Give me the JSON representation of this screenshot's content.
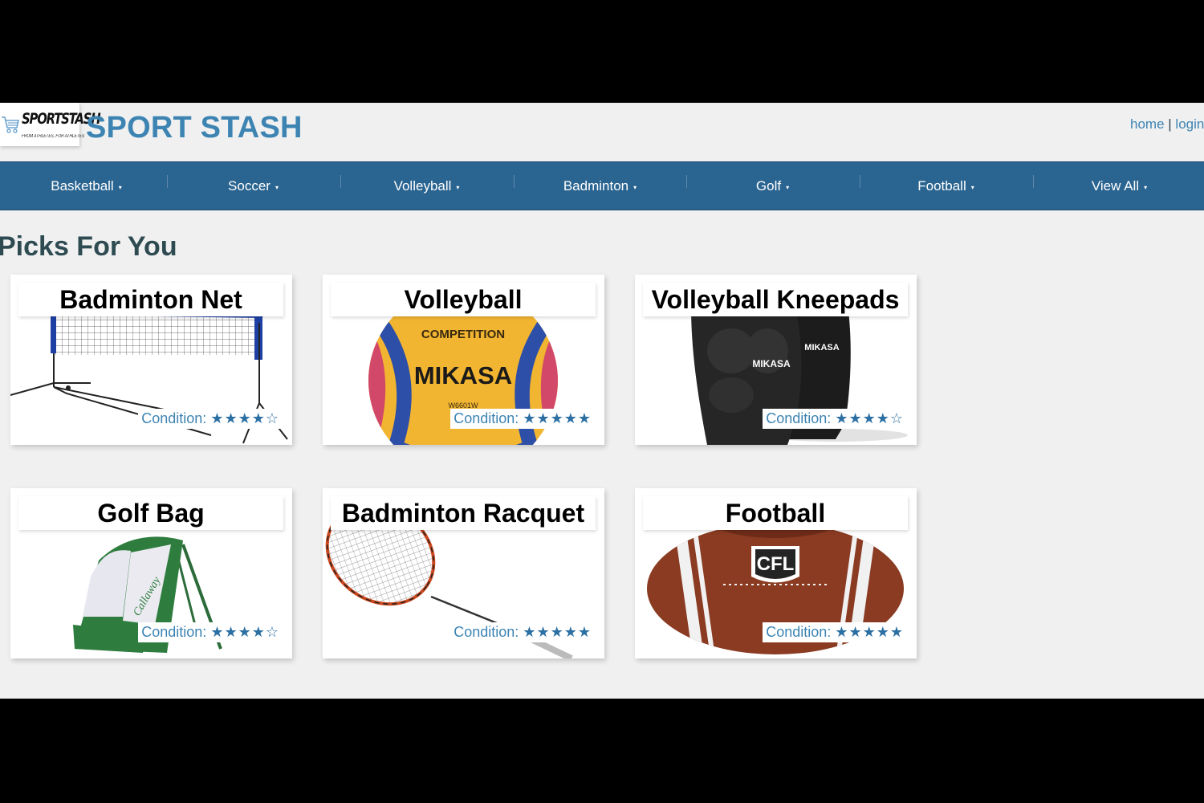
{
  "header": {
    "logo_word": "SPORTSTASH",
    "logo_tagline": "FROM ATHLETES, FOR ATHLETES",
    "title": "SPORT STASH",
    "links": {
      "home": "home",
      "separator": "|",
      "login": "login"
    }
  },
  "nav": {
    "items": [
      {
        "label": "Basketball",
        "caret": "▾"
      },
      {
        "label": "Soccer",
        "caret": "▾"
      },
      {
        "label": "Volleyball",
        "caret": "▾"
      },
      {
        "label": "Badminton",
        "caret": "▾"
      },
      {
        "label": "Golf",
        "caret": "▾"
      },
      {
        "label": "Football",
        "caret": "▾"
      },
      {
        "label": "View All",
        "caret": "▾"
      }
    ]
  },
  "picks": {
    "title": "Picks For You",
    "condition_label": "Condition:",
    "items": [
      {
        "title": "Badminton Net",
        "rating": 4,
        "stars": "★★★★☆",
        "image_icon": "badminton-net-image"
      },
      {
        "title": "Volleyball",
        "rating": 5,
        "stars": "★★★★★",
        "image_icon": "volleyball-image",
        "image_text": [
          "COMPETITION",
          "MIKASA",
          "W6601W"
        ]
      },
      {
        "title": "Volleyball Kneepads",
        "rating": 4,
        "stars": "★★★★☆",
        "image_icon": "kneepads-image",
        "image_text": [
          "MIKASA",
          "MIKASA"
        ]
      },
      {
        "title": "Golf Bag",
        "rating": 4,
        "stars": "★★★★☆",
        "image_icon": "golf-bag-image",
        "image_text": [
          "Callaway"
        ]
      },
      {
        "title": "Badminton Racquet",
        "rating": 5,
        "stars": "★★★★★",
        "image_icon": "badminton-racquet-image"
      },
      {
        "title": "Football",
        "rating": 5,
        "stars": "★★★★★",
        "image_icon": "football-image",
        "image_text": [
          "CFL"
        ]
      }
    ]
  },
  "colors": {
    "brand_blue": "#3d84b3",
    "nav_blue": "#2a6490",
    "star_blue": "#2b6fa3",
    "page_bg": "#f0f0f0",
    "heading": "#2f4b52"
  }
}
